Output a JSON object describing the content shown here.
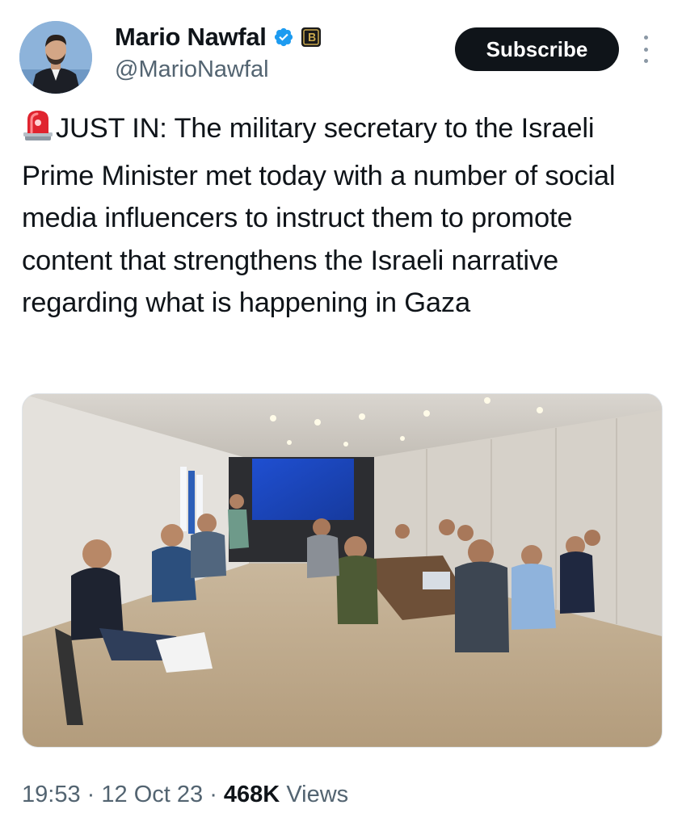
{
  "author": {
    "display_name": "Mario Nawfal",
    "handle": "@MarioNawfal"
  },
  "actions": {
    "subscribe_label": "Subscribe"
  },
  "tweet": {
    "text": "JUST IN: The military secretary to the Israeli Prime Minister met today with a number of social media influencers to instruct them to promote content that strengthens the Israeli narrative regarding what is happening in Gaza"
  },
  "meta": {
    "time": "19:53",
    "separator": "·",
    "date": "12 Oct 23",
    "views_count": "468K",
    "views_label": "Views"
  },
  "icons": {
    "verified": "verified-badge-icon",
    "affiliate": "affiliate-badge-icon",
    "siren": "rotating-light-icon",
    "more": "more-options-icon"
  },
  "colors": {
    "text_primary": "#0f1419",
    "text_secondary": "#536471",
    "verified_blue": "#1d9bf0",
    "button_bg": "#0f1419"
  }
}
